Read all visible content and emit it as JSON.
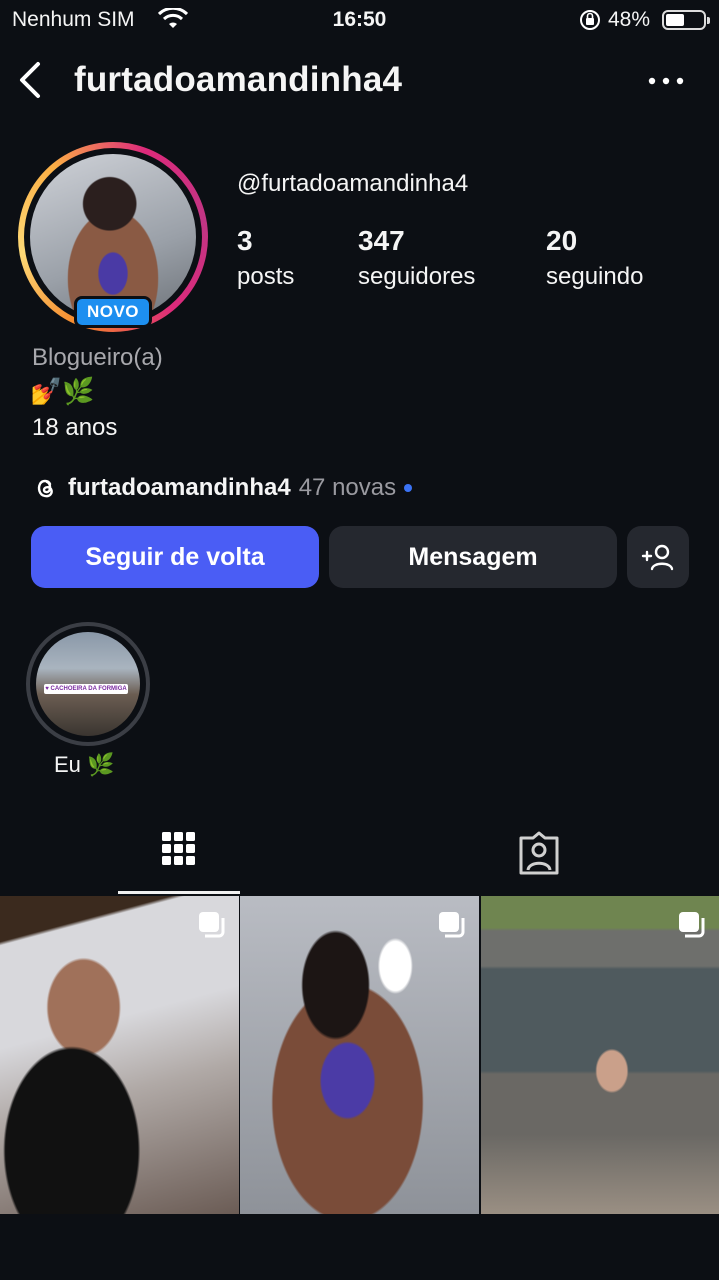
{
  "status_bar": {
    "carrier": "Nenhum SIM",
    "time": "16:50",
    "battery": "48%",
    "battery_level": 0.48,
    "icons": [
      "wifi-icon",
      "orientation-lock-icon",
      "battery-icon"
    ]
  },
  "header": {
    "title": "furtadoamandinha4",
    "back_icon": "chevron-left-icon",
    "more_icon": "more-horizontal-icon"
  },
  "profile": {
    "badge": "NOVO",
    "handle": "@furtadoamandinha4",
    "stats": [
      {
        "value": "3",
        "label": "posts"
      },
      {
        "value": "347",
        "label": "seguidores"
      },
      {
        "value": "20",
        "label": "seguindo"
      }
    ],
    "category": "Blogueiro(a)",
    "emoji_line": "💅🌿",
    "age": "18 anos"
  },
  "threads": {
    "icon": "threads-icon",
    "name": "furtadoamandinha4",
    "count": "47 novas"
  },
  "buttons": {
    "follow": "Seguir de volta",
    "message": "Mensagem",
    "add_user_icon": "add-person-icon"
  },
  "highlights": [
    {
      "label": "Eu 🌿",
      "overlay_text": "♥ CACHOEIRA DA FORMIGA"
    }
  ],
  "tabs": [
    {
      "icon": "grid-icon",
      "selected": true
    },
    {
      "icon": "tagged-person-icon",
      "selected": false
    }
  ],
  "colors": {
    "background": "#0c0f14",
    "follow_button": "#4a5df5",
    "secondary_button": "#25282f",
    "badge": "#1d8ff0",
    "threads_dot": "#3b73f6"
  }
}
